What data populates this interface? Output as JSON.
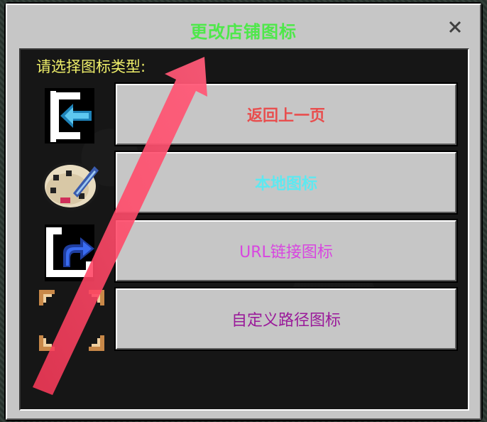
{
  "dialog": {
    "title": "更改店铺图标",
    "close_label": "×"
  },
  "prompt": "请选择图标类型:",
  "buttons": [
    {
      "label": "返回上一页",
      "icon": "back-arrow-icon"
    },
    {
      "label": "本地图标",
      "icon": "palette-brush-icon"
    },
    {
      "label": "URL链接图标",
      "icon": "share-link-icon"
    },
    {
      "label": "自定义路径图标",
      "icon": "custom-path-frame-icon"
    }
  ],
  "colors": {
    "title": "#4ee84a",
    "prompt": "#f0f06a",
    "back": "#e84e4e",
    "local": "#5ee8f0",
    "url": "#d846e0",
    "custom": "#9a1a9a",
    "annotation_arrow": "#ff4a6a"
  }
}
